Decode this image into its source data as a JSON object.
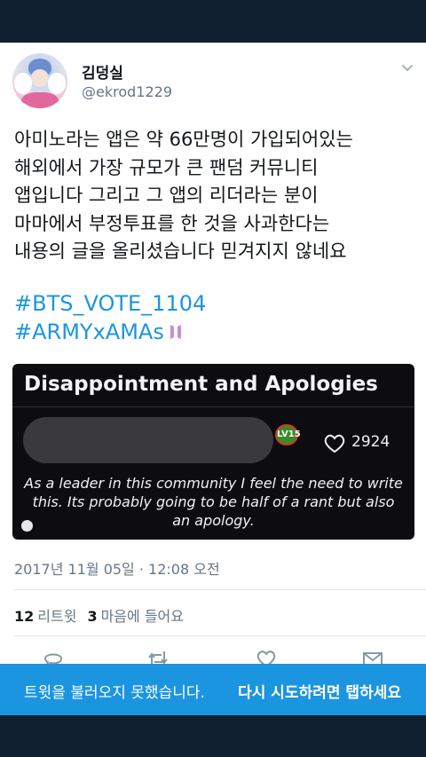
{
  "user": {
    "display_name": "김덩실",
    "handle": "@ekrod1229"
  },
  "tweet": {
    "lines": [
      "아미노라는 앱은 약 66만명이 가입되어있는",
      "해외에서 가장 규모가 큰 팬덤 커뮤니티",
      "앱입니다 그리고 그 앱의 리더라는 분이",
      "마마에서 부정투표를 한 것을 사과한다는",
      "내용의 글을 올리셨습니다 믿겨지지 않네요"
    ],
    "hashtags": [
      "#BTS_VOTE_1104",
      "#ARMYxAMAs"
    ]
  },
  "media": {
    "title": "Disappointment and Apologies",
    "badge": "LV15",
    "likes": "2924",
    "body_lines": [
      "As a leader in this community I feel the need to write",
      "this. Its probably going to be half of a rant but also",
      "an apology."
    ]
  },
  "timestamp": "2017년 11월 05일 · 12:08 오전",
  "stats": {
    "retweets_count": "12",
    "retweets_label": "리트윗",
    "likes_count": "3",
    "likes_label": "마음에 들어요"
  },
  "actions": [
    "reply-icon",
    "retweet-icon",
    "like-icon",
    "share-icon"
  ],
  "toast": {
    "message": "트윗을 불러오지 못했습니다.",
    "retry": "다시 시도하려면 탭하세요"
  },
  "colors": {
    "accent": "#1b95e0",
    "frame": "#10202e",
    "text": "#14171a",
    "muted": "#657786"
  }
}
